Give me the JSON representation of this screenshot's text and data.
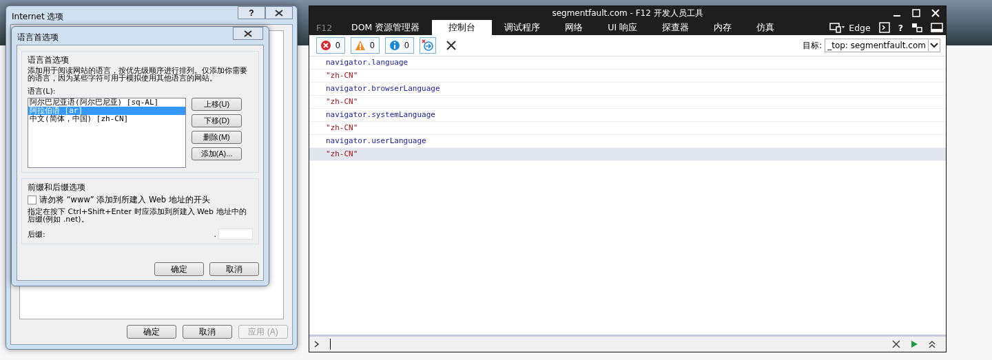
{
  "internet_options": {
    "title": "Internet 选项",
    "help": "?",
    "buttons": [
      {
        "label": "确定",
        "disabled": false
      },
      {
        "label": "取消",
        "disabled": false
      },
      {
        "label": "应用 (A)",
        "disabled": true
      }
    ]
  },
  "language_dialog": {
    "title": "语言首选项",
    "language_group": {
      "title": "语言首选项",
      "description": "添加用于阅读网站的语言，按优先级顺序进行排列。仅添加你需要的语言，因为某些字符可用于模拟使用其他语言的网站。",
      "list_label": "语言(L):",
      "languages": [
        {
          "label": "阿尔巴尼亚语(阿尔巴尼亚) [sq-AL]",
          "selected": false
        },
        {
          "label": "阿拉伯语 [ar]",
          "selected": true
        },
        {
          "label": "中文(简体，中国) [zh-CN]",
          "selected": false
        }
      ],
      "buttons": [
        "上移(U)",
        "下移(D)",
        "删除(M)",
        "添加(A)..."
      ]
    },
    "suffix_group": {
      "title": "前缀和后缀选项",
      "checkbox": {
        "label": "请勿将 “www” 添加到所建入 Web 地址的开头",
        "checked": false
      },
      "description": "指定在按下 Ctrl+Shift+Enter 时应添加到所建入 Web 地址中的后缀(例如 .net)。",
      "suffix_label": "后缀:",
      "suffix_dot": "."
    },
    "buttons": [
      "确定",
      "取消"
    ]
  },
  "devtools": {
    "title": "segmentfault.com - F12 开发人员工具",
    "brand": "F12",
    "tabs": [
      {
        "label": "DOM 资源管理器",
        "selected": false
      },
      {
        "label": "控制台",
        "selected": true
      },
      {
        "label": "调试程序",
        "selected": false
      },
      {
        "label": "网络",
        "selected": false
      },
      {
        "label": "UI 响应",
        "selected": false
      },
      {
        "label": "探查器",
        "selected": false
      },
      {
        "label": "内存",
        "selected": false
      },
      {
        "label": "仿真",
        "selected": false
      }
    ],
    "mode": "Edge",
    "help": "?",
    "counters": [
      {
        "kind": "error",
        "count": "0"
      },
      {
        "kind": "warning",
        "count": "0"
      },
      {
        "kind": "info",
        "count": "0"
      }
    ],
    "target_label": "目标:",
    "target_value": "_top: segmentfault.com",
    "console_lines": [
      {
        "kind": "input",
        "text": "navigator.language",
        "selected": false
      },
      {
        "kind": "output",
        "text": "\"zh-CN\"",
        "selected": false
      },
      {
        "kind": "input",
        "text": "navigator.browserLanguage",
        "selected": false
      },
      {
        "kind": "output",
        "text": "\"zh-CN\"",
        "selected": false
      },
      {
        "kind": "input",
        "text": "navigator.systemLanguage",
        "selected": false
      },
      {
        "kind": "output",
        "text": "\"zh-CN\"",
        "selected": false
      },
      {
        "kind": "input",
        "text": "navigator.userLanguage",
        "selected": false
      },
      {
        "kind": "output",
        "text": "\"zh-CN\"",
        "selected": true
      }
    ]
  }
}
